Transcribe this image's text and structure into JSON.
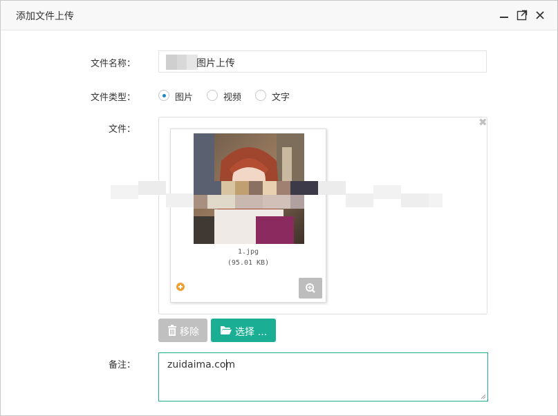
{
  "window": {
    "title": "添加文件上传",
    "controls": [
      "minimize-icon",
      "maximize-icon",
      "close-icon"
    ]
  },
  "form": {
    "name_label": "文件名称：",
    "name_value": "图片上传",
    "type_label": "文件类型：",
    "type_options": [
      {
        "label": "图片",
        "selected": true
      },
      {
        "label": "视频",
        "selected": false
      },
      {
        "label": "文字",
        "selected": false
      }
    ],
    "file_label": "文件：",
    "remark_label": "备注：",
    "remark_value": "zuidaima.com"
  },
  "upload": {
    "file_name": "1.jpg",
    "file_size": "(95.01 KB)",
    "clear_icon": "close-x-icon",
    "remove_label": "移除",
    "remove_icon": "trash-icon",
    "choose_label": "选择 …",
    "choose_icon": "folder-open-icon"
  },
  "colors": {
    "accent": "#1aaf94",
    "radio_selected": "#1e88c7",
    "remove_button": "#c0c0c0",
    "plus_icon": "#f0a030"
  }
}
